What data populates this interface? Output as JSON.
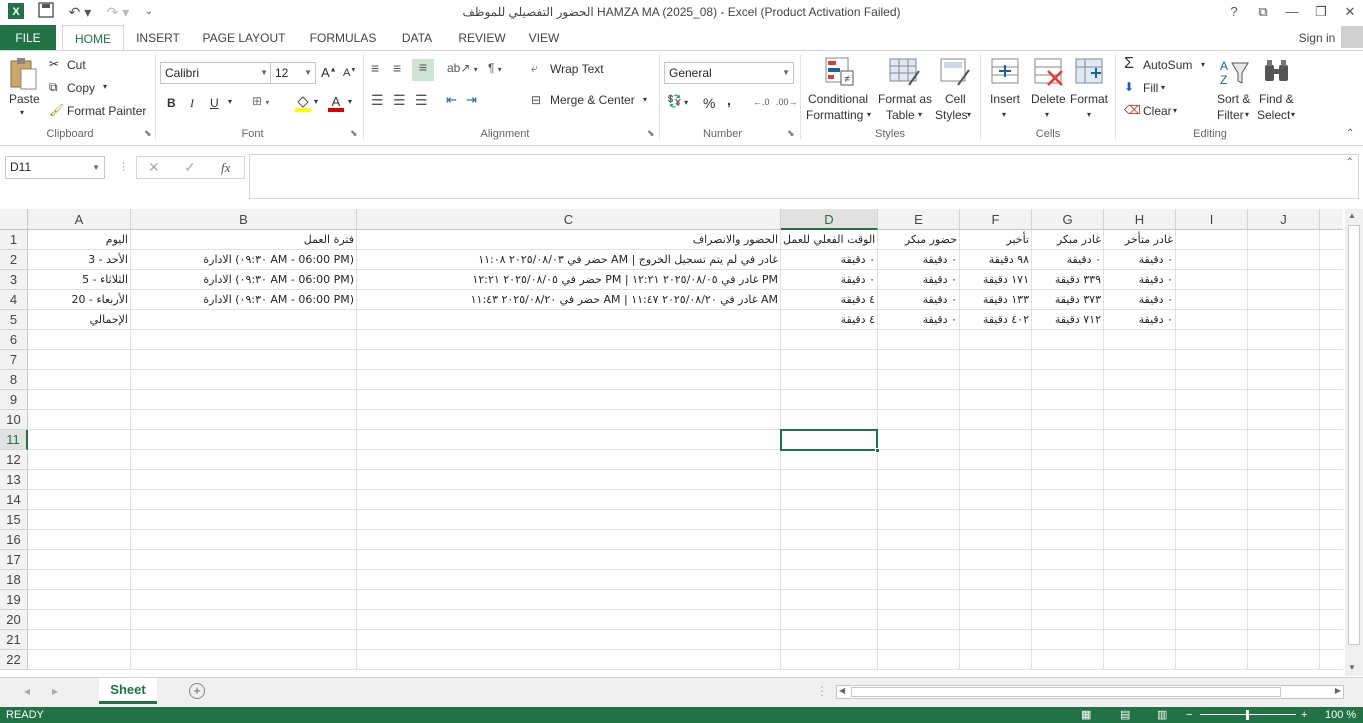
{
  "title_bar": {
    "title": "الحضور التفصيلي للموظف HAMZA MA (2025_08) - Excel (Product Activation Failed)",
    "help": "?"
  },
  "tabs": [
    "FILE",
    "HOME",
    "INSERT",
    "PAGE LAYOUT",
    "FORMULAS",
    "DATA",
    "REVIEW",
    "VIEW"
  ],
  "account": "Sign in",
  "ribbon": {
    "clipboard": {
      "paste": "Paste",
      "cut": "Cut",
      "copy": "Copy",
      "format_painter": "Format Painter",
      "label": "Clipboard"
    },
    "font": {
      "name": "Calibri",
      "size": "12",
      "bold": "B",
      "italic": "I",
      "underline": "U",
      "label": "Font"
    },
    "alignment": {
      "wrap": "Wrap Text",
      "merge": "Merge & Center",
      "label": "Alignment"
    },
    "number": {
      "format": "General",
      "percent": "%",
      "comma": ",",
      "label": "Number"
    },
    "styles": {
      "conditional_1": "Conditional",
      "conditional_2": "Formatting",
      "table_1": "Format as",
      "table_2": "Table",
      "cell_1": "Cell",
      "cell_2": "Styles",
      "label": "Styles"
    },
    "cells": {
      "insert": "Insert",
      "delete": "Delete",
      "format": "Format",
      "label": "Cells"
    },
    "editing": {
      "autosum": "AutoSum",
      "fill": "Fill",
      "clear": "Clear",
      "sort_1": "Sort &",
      "sort_2": "Filter",
      "find_1": "Find &",
      "find_2": "Select",
      "label": "Editing"
    }
  },
  "formula_bar": {
    "name_box": "D11",
    "fx": "fx",
    "formula": ""
  },
  "columns": [
    "A",
    "B",
    "C",
    "D",
    "E",
    "F",
    "G",
    "H",
    "I",
    "J"
  ],
  "rows": [
    "1",
    "2",
    "3",
    "4",
    "5",
    "6",
    "7",
    "8",
    "9",
    "10",
    "11",
    "12",
    "13",
    "14",
    "15",
    "16",
    "17",
    "18",
    "19",
    "20",
    "21",
    "22"
  ],
  "cells": [
    [
      "اليوم",
      "فترة العمل",
      "الحضور والانصراف",
      "الوقت الفعلي للعمل",
      "حضور مبكر",
      "تأخير",
      "غادر مبكر",
      "غادر متأخر"
    ],
    [
      "الأحد - 3",
      "الادارة (٠٩:٣٠ AM - 06:00 PM)",
      "حضر في ٢٠٢٥/٠٨/٠٣ ١١:٠٨ AM | غادر في لم يتم تسجيل الخروج",
      "٠ دقيقة",
      "٠ دقيقة",
      "٩٨ دقيقة",
      "٠ دقيقة",
      "٠ دقيقة"
    ],
    [
      "الثلاثاء - 5",
      "الادارة (٠٩:٣٠ AM - 06:00 PM)",
      "حضر في ٢٠٢٥/٠٨/٠٥ ١٢:٢١ PM | غادر في ٢٠٢٥/٠٨/٠٥ ١٢:٢١ PM",
      "٠ دقيقة",
      "٠ دقيقة",
      "١٧١ دقيقة",
      "٣٣٩ دقيقة",
      "٠ دقيقة"
    ],
    [
      "الأربعاء - 20",
      "الادارة (٠٩:٣٠ AM - 06:00 PM)",
      "حضر في ٢٠٢٥/٠٨/٢٠ ١١:٤٣ AM | غادر في ٢٠٢٥/٠٨/٢٠ ١١:٤٧ AM",
      "٤ دقيقة",
      "٠ دقيقة",
      "١٣٣ دقيقة",
      "٣٧٣ دقيقة",
      "٠ دقيقة"
    ],
    [
      "الإجمالي",
      "",
      "",
      "٤ دقيقة",
      "٠ دقيقة",
      "٤٠٢ دقيقة",
      "٧١٢ دقيقة",
      "٠ دقيقة"
    ]
  ],
  "sheet": {
    "tab": "Sheet",
    "add": "+"
  },
  "status": {
    "ready": "READY",
    "zoom": "100 %"
  }
}
